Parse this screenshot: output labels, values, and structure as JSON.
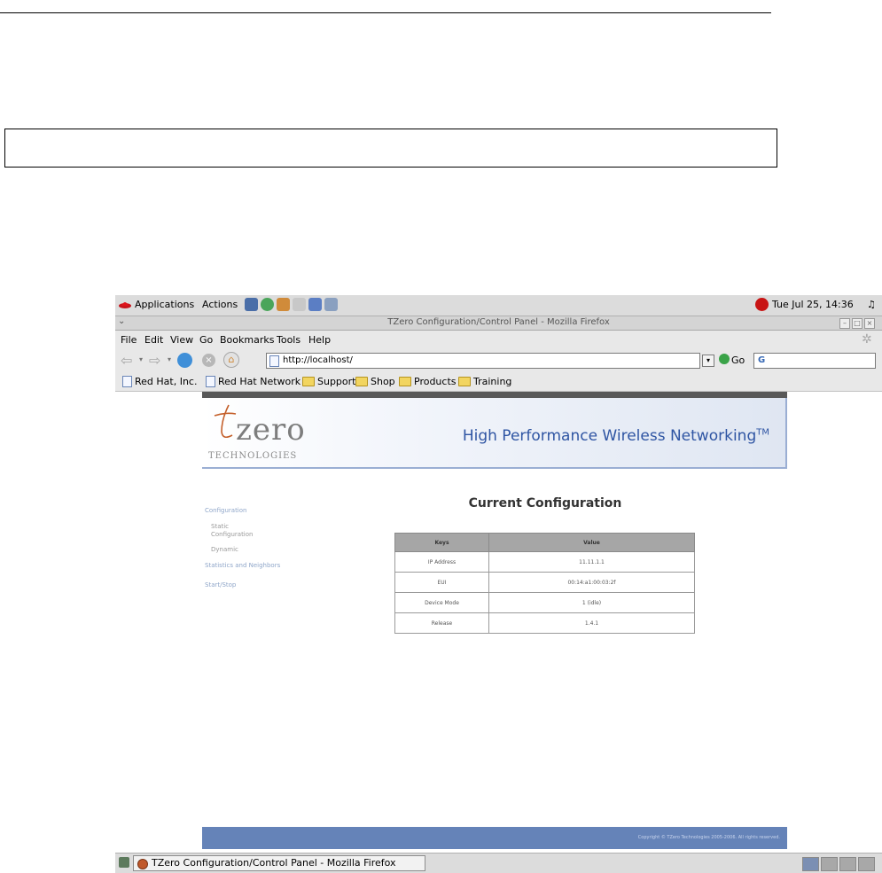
{
  "panel": {
    "applications": "Applications",
    "actions": "Actions",
    "clock": "Tue Jul 25, 14:36"
  },
  "window": {
    "title": "TZero Configuration/Control Panel - Mozilla Firefox"
  },
  "menu": [
    "File",
    "Edit",
    "View",
    "Go",
    "Bookmarks",
    "Tools",
    "Help"
  ],
  "toolbar": {
    "url": "http://localhost/",
    "go_label": "Go"
  },
  "bookmarks": [
    {
      "label": "Red Hat, Inc.",
      "type": "page"
    },
    {
      "label": "Red Hat Network",
      "type": "page"
    },
    {
      "label": "Support",
      "type": "folder"
    },
    {
      "label": "Shop",
      "type": "folder"
    },
    {
      "label": "Products",
      "type": "folder"
    },
    {
      "label": "Training",
      "type": "folder"
    }
  ],
  "site": {
    "logo_word": "zero",
    "logo_sub": "TECHNOLOGIES",
    "tagline": "High Performance Wireless Networking",
    "tagline_tm": "TM",
    "nav": {
      "configuration": "Configuration",
      "static": "Static",
      "configuration_sub": "Configuration",
      "dynamic": "Dynamic",
      "stats": "Statistics and Neighbors",
      "startstop": "Start/Stop"
    },
    "heading": "Current Configuration",
    "table": {
      "headers": [
        "Keys",
        "Value"
      ],
      "rows": [
        [
          "IP Address",
          "11.11.1.1"
        ],
        [
          "EUI",
          "00:14:a1:00:03:2f"
        ],
        [
          "Device Mode",
          "1 (idle)"
        ],
        [
          "Release",
          "1.4.1"
        ]
      ]
    },
    "footer": "Copyright © TZero Technologies 2005-2006. All rights reserved."
  },
  "taskbar": {
    "task": "TZero Configuration/Control Panel - Mozilla Firefox"
  },
  "colors": {
    "link": "#2f55a3",
    "footer_bg": "#6583b8",
    "table_header": "#a6a6a6"
  }
}
